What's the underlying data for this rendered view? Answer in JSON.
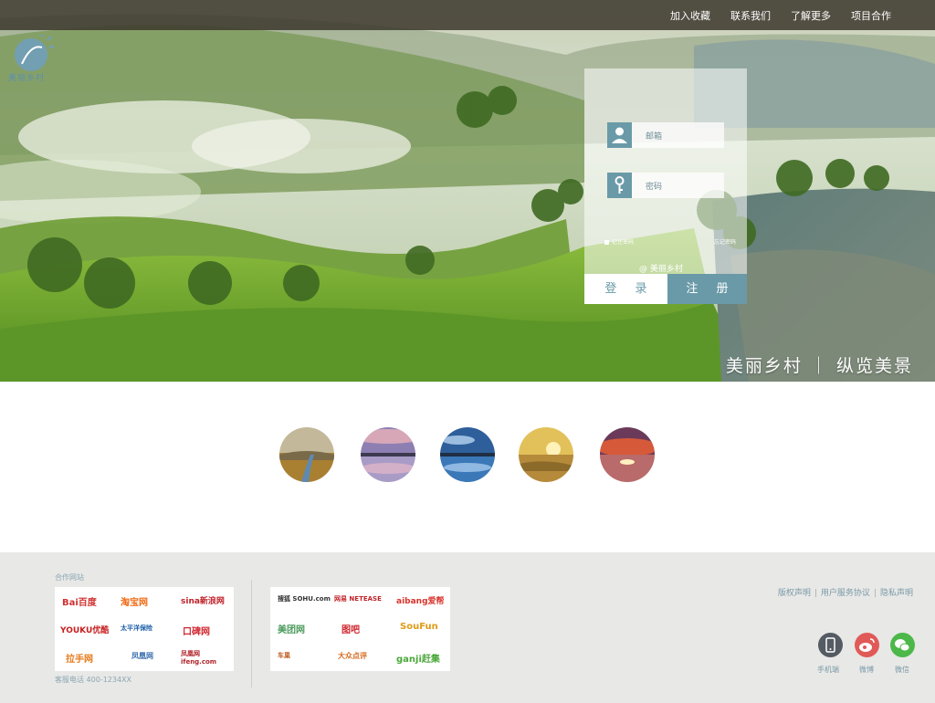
{
  "nav": {
    "items": [
      "加入收藏",
      "联系我们",
      "了解更多",
      "项目合作"
    ]
  },
  "logo": {
    "text": "美丽乡村"
  },
  "login": {
    "email_label": "邮箱",
    "password_label": "密码",
    "remember_label": "记住密码",
    "forgot_label": "忘记密码",
    "brand": "@ 美丽乡村",
    "login_button": "登 录",
    "register_button": "注 册"
  },
  "slogan": "美丽乡村 ｜ 纵览美景",
  "gallery": {
    "thumbnails": [
      "landscape-thumb-1",
      "landscape-thumb-2",
      "landscape-thumb-3",
      "landscape-thumb-4",
      "landscape-thumb-5"
    ]
  },
  "footer": {
    "partner_title": "合作网站",
    "hotline": "客服电话 400-1234XX",
    "partners_left": [
      "Bai百度",
      "淘宝网",
      "sina新浪网",
      "YOUKU优酷",
      "太平洋保险",
      "口碑网",
      "拉手网",
      "凤凰网",
      "凤凰网 ifeng.com"
    ],
    "partners_right": [
      "搜狐 SOHU.com",
      "网易 NETEASE",
      "aibang爱帮",
      "美团网",
      "图吧",
      "SouFun",
      "车巢",
      "大众点评",
      "ganji赶集"
    ],
    "links": [
      "版权声明",
      "用户服务协议",
      "隐私声明"
    ],
    "social": [
      {
        "label": "手机端",
        "icon": "mobile-icon",
        "color": "#555b62"
      },
      {
        "label": "微博",
        "icon": "weibo-icon",
        "color": "#e05a57"
      },
      {
        "label": "微信",
        "icon": "wechat-icon",
        "color": "#4cb84a"
      }
    ]
  },
  "colors": {
    "accent": "#6a9aa8",
    "footer_bg": "#e8e8e6",
    "topbar": "#3c372d"
  }
}
